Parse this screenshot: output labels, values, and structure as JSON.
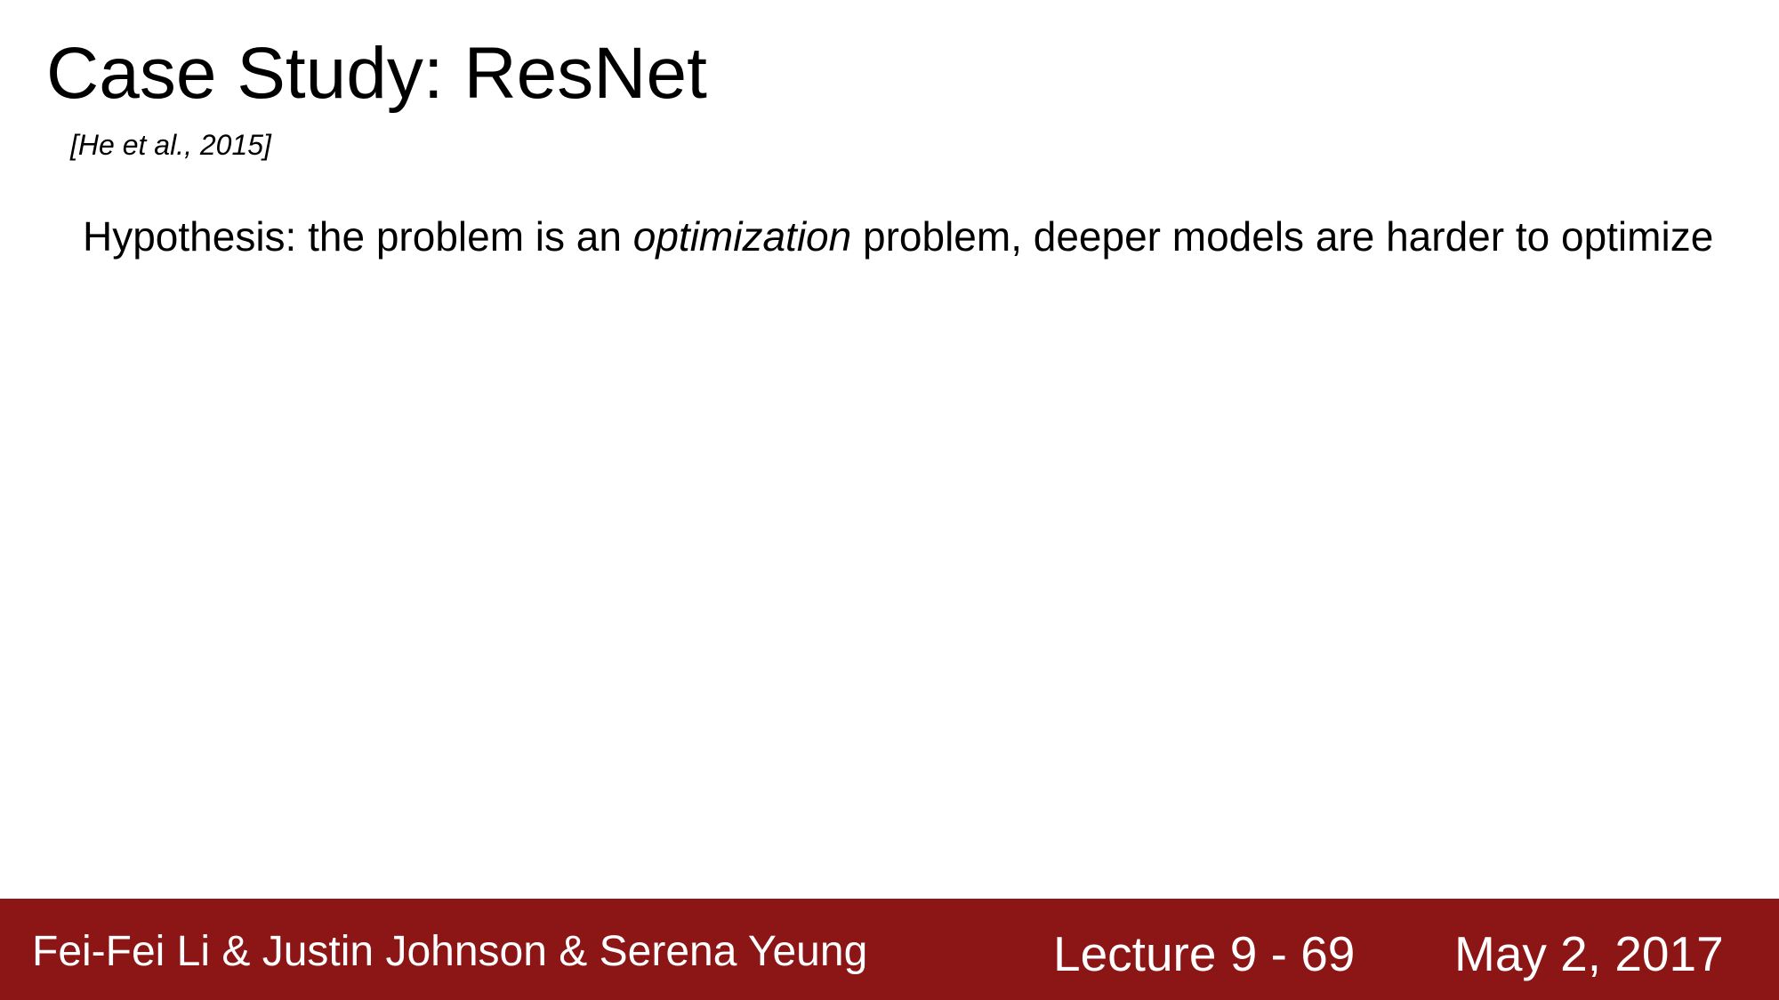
{
  "slide": {
    "title": "Case Study: ResNet",
    "citation": "[He et al., 2015]",
    "body": {
      "before": "Hypothesis: the problem is an ",
      "emphasis": "optimization",
      "after": " problem, deeper models are harder to optimize"
    }
  },
  "footer": {
    "authors": "Fei-Fei Li & Justin Johnson & Serena Yeung",
    "lecture": "Lecture 9 - 69",
    "date": "May 2, 2017",
    "background_color": "#8c1515"
  }
}
